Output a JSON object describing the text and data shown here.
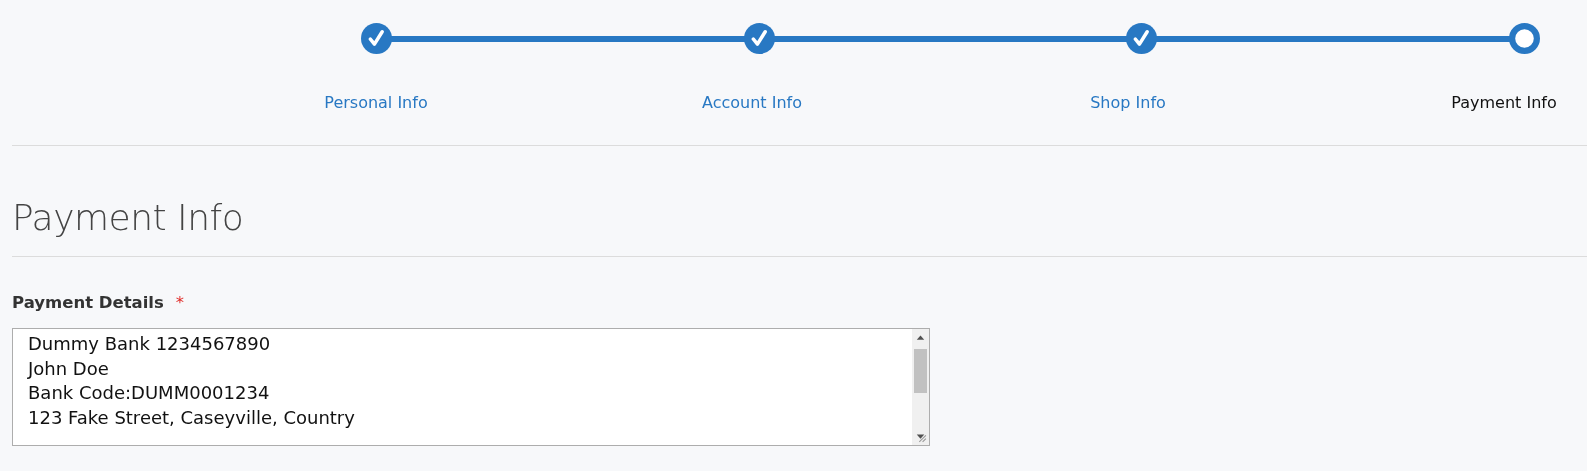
{
  "steps": [
    {
      "label": "Personal Info",
      "completed": true,
      "selected": false
    },
    {
      "label": "Account Info",
      "completed": true,
      "selected": false
    },
    {
      "label": "Shop Info",
      "completed": true,
      "selected": false
    },
    {
      "label": "Payment Info",
      "completed": false,
      "selected": true
    }
  ],
  "heading": "Payment Info",
  "field": {
    "label": "Payment Details",
    "required": true,
    "required_mark": "*",
    "value": "Dummy Bank 1234567890\nJohn Doe\nBank Code:DUMM0001234\n123 Fake Street, Caseyville, Country"
  }
}
